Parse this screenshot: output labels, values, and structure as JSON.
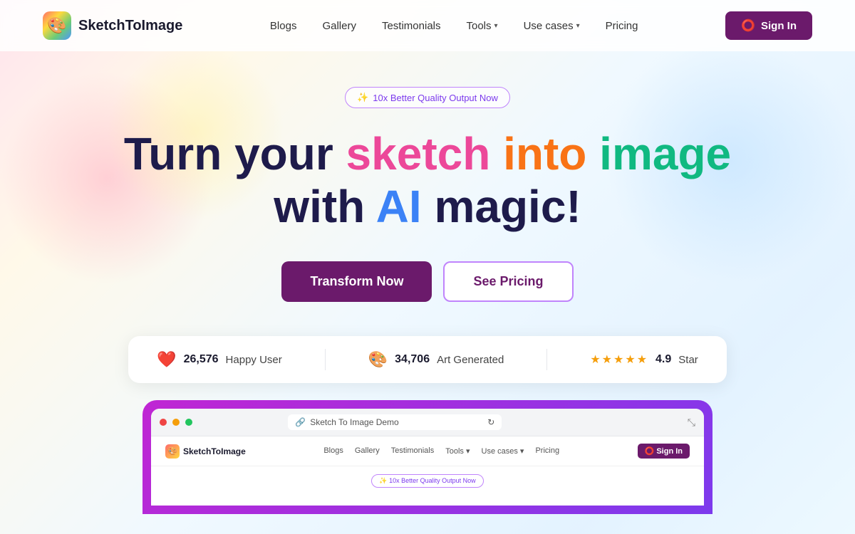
{
  "brand": {
    "name": "SketchToImage",
    "logo_emoji": "🎨"
  },
  "navbar": {
    "links": [
      {
        "label": "Blogs",
        "has_dropdown": false
      },
      {
        "label": "Gallery",
        "has_dropdown": false
      },
      {
        "label": "Testimonials",
        "has_dropdown": false
      },
      {
        "label": "Tools",
        "has_dropdown": true
      },
      {
        "label": "Use cases",
        "has_dropdown": true
      },
      {
        "label": "Pricing",
        "has_dropdown": false
      }
    ],
    "signin_label": "Sign In"
  },
  "hero": {
    "badge": "✨ 10x Better Quality Output Now",
    "heading_line1_part1": "Turn your ",
    "heading_line1_sketch": "sketch",
    "heading_line1_into": "into",
    "heading_line1_image": "image",
    "heading_line2_with": "with ",
    "heading_line2_ai": "AI",
    "heading_line2_magic": "magic!",
    "cta_primary": "Transform Now",
    "cta_secondary": "See Pricing"
  },
  "stats": {
    "happy_user_icon": "❤️",
    "happy_user_count": "26,576",
    "happy_user_label": "Happy User",
    "art_generated_icon": "🎨",
    "art_generated_count": "34,706",
    "art_generated_label": "Art Generated",
    "rating": "4.9",
    "rating_label": "Star",
    "stars": "★★★★★"
  },
  "demo": {
    "url_text": "Sketch To Image Demo",
    "inner_nav": {
      "brand": "SketchToImage",
      "links": [
        "Blogs",
        "Gallery",
        "Testimonials",
        "Tools ▾",
        "Use cases ▾",
        "Pricing"
      ],
      "signin": "Sign In"
    },
    "inner_badge": "✨ 10x Better Quality Output Now"
  }
}
